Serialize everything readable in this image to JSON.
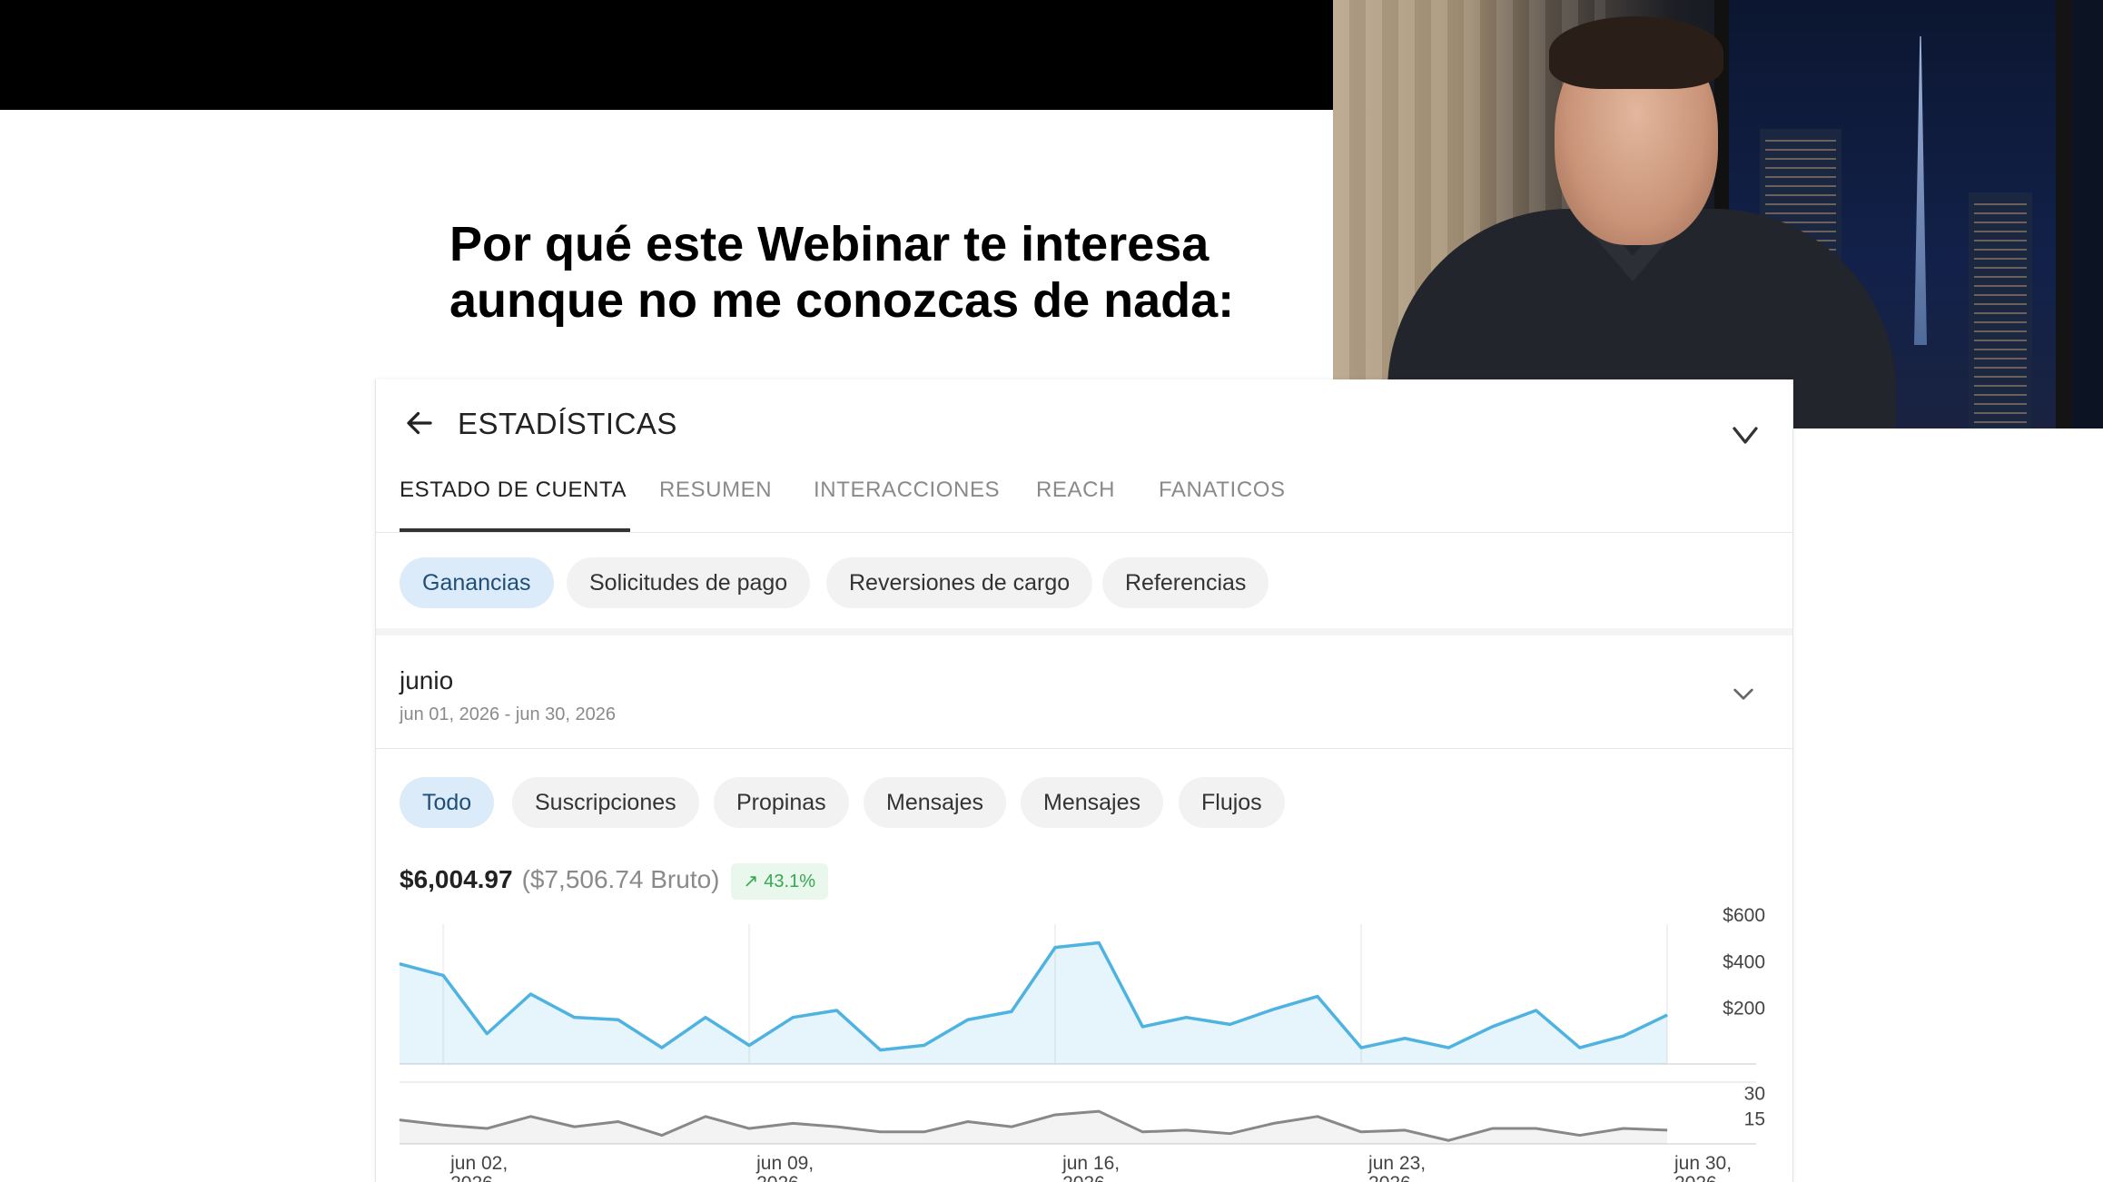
{
  "slide": {
    "headline_lines": [
      "Por qué este Webinar te interesa",
      "aunque no me conozcas de nada:"
    ]
  },
  "video": {
    "icon": "webcam-person-icon"
  },
  "stats": {
    "title": "ESTADÍSTICAS",
    "tabs": [
      {
        "label": "ESTADO DE CUENTA",
        "active": true
      },
      {
        "label": "RESUMEN",
        "active": false
      },
      {
        "label": "INTERACCIONES",
        "active": false
      },
      {
        "label": "REACH",
        "active": false
      },
      {
        "label": "FANATICOS",
        "active": false
      }
    ],
    "filter_chips": [
      {
        "label": "Ganancias",
        "active": true
      },
      {
        "label": "Solicitudes de pago",
        "active": false
      },
      {
        "label": "Reversiones de cargo",
        "active": false
      },
      {
        "label": "Referencias",
        "active": false
      }
    ],
    "period": {
      "name": "junio",
      "range": "jun 01, 2026 - jun 30, 2026"
    },
    "type_chips": [
      {
        "label": "Todo",
        "active": true
      },
      {
        "label": "Suscripciones",
        "active": false
      },
      {
        "label": "Propinas",
        "active": false
      },
      {
        "label": "Mensajes",
        "active": false
      },
      {
        "label": "Mensajes",
        "active": false
      },
      {
        "label": "Flujos",
        "active": false
      }
    ],
    "summary": {
      "net": "$6,004.97",
      "gross": "($7,506.74 Bruto)",
      "growth": "43.1%"
    },
    "colors": {
      "accent": "#4eb3e0",
      "active_chip": "#dcebf9",
      "growth_green": "#34a853",
      "secondary_line": "#888888"
    }
  },
  "chart_data": {
    "type": "line",
    "x": [
      "jun 01",
      "jun 02",
      "jun 03",
      "jun 04",
      "jun 05",
      "jun 06",
      "jun 07",
      "jun 08",
      "jun 09",
      "jun 10",
      "jun 11",
      "jun 12",
      "jun 13",
      "jun 14",
      "jun 15",
      "jun 16",
      "jun 17",
      "jun 18",
      "jun 19",
      "jun 20",
      "jun 21",
      "jun 22",
      "jun 23",
      "jun 24",
      "jun 25",
      "jun 26",
      "jun 27",
      "jun 28",
      "jun 29",
      "jun 30"
    ],
    "xtick_labels": [
      "jun 02,\n2026",
      "jun 09,\n2026",
      "jun 16,\n2026",
      "jun 23,\n2026",
      "jun 30,\n2026"
    ],
    "series": [
      {
        "panel": "earnings",
        "values": [
          430,
          380,
          130,
          300,
          200,
          190,
          70,
          200,
          80,
          200,
          230,
          60,
          80,
          190,
          225,
          500,
          520,
          160,
          200,
          170,
          235,
          290,
          70,
          110,
          70,
          160,
          230,
          70,
          120,
          210
        ]
      },
      {
        "panel": "count",
        "values": [
          14,
          11,
          9,
          16,
          10,
          13,
          5,
          16,
          9,
          12,
          10,
          7,
          7,
          13,
          10,
          17,
          19,
          7,
          8,
          6,
          12,
          16,
          7,
          8,
          2,
          9,
          9,
          5,
          9,
          8
        ]
      }
    ],
    "panels": [
      {
        "name": "earnings",
        "yticks": [
          "$600",
          "$400",
          "$200"
        ],
        "ylim": [
          0,
          600
        ]
      },
      {
        "name": "count",
        "yticks": [
          "30",
          "15"
        ],
        "ylim": [
          0,
          35
        ]
      }
    ]
  }
}
